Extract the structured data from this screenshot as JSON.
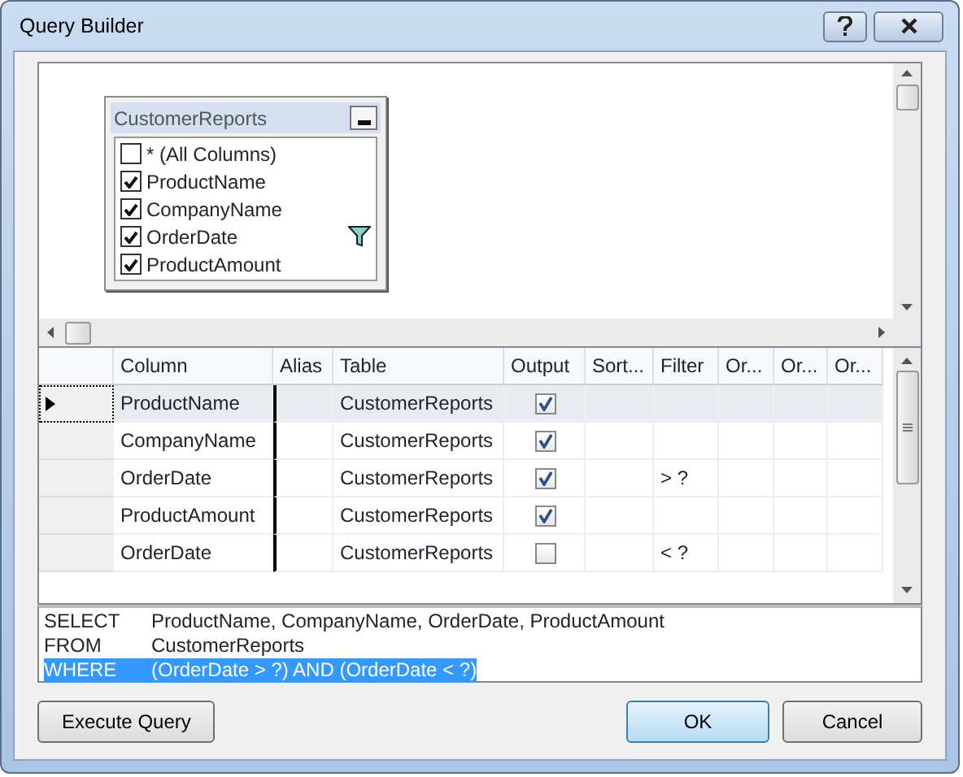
{
  "window": {
    "title": "Query Builder"
  },
  "diagram": {
    "table": {
      "title": "CustomerReports",
      "fields": [
        {
          "name": "* (All Columns)",
          "checked": false,
          "filtered": false
        },
        {
          "name": "ProductName",
          "checked": true,
          "filtered": false
        },
        {
          "name": "CompanyName",
          "checked": true,
          "filtered": false
        },
        {
          "name": "OrderDate",
          "checked": true,
          "filtered": true
        },
        {
          "name": "ProductAmount",
          "checked": true,
          "filtered": false
        }
      ]
    }
  },
  "grid": {
    "columns": [
      "Column",
      "Alias",
      "Table",
      "Output",
      "Sort...",
      "Filter",
      "Or...",
      "Or...",
      "Or..."
    ],
    "rows": [
      {
        "column": "ProductName",
        "table": "CustomerReports",
        "output": true,
        "selected": true
      },
      {
        "column": "CompanyName",
        "table": "CustomerReports",
        "output": true,
        "selected": false
      },
      {
        "column": "OrderDate",
        "table": "CustomerReports",
        "output": true,
        "filter": "> ?",
        "selected": false
      },
      {
        "column": "ProductAmount",
        "table": "CustomerReports",
        "output": true,
        "selected": false
      },
      {
        "column": "OrderDate",
        "table": "CustomerReports",
        "output": false,
        "filter": "< ?",
        "selected": false
      }
    ]
  },
  "sql": [
    {
      "keyword": "SELECT",
      "text": "ProductName, CompanyName, OrderDate, ProductAmount",
      "selected": false
    },
    {
      "keyword": "FROM",
      "text": "CustomerReports",
      "selected": false
    },
    {
      "keyword": "WHERE",
      "text": "(OrderDate > ?) AND (OrderDate < ?)",
      "selected": true
    }
  ],
  "buttons": [
    {
      "label": "Execute Query",
      "default": false
    },
    {
      "label": "OK",
      "default": true
    },
    {
      "label": "Cancel",
      "default": false
    }
  ]
}
